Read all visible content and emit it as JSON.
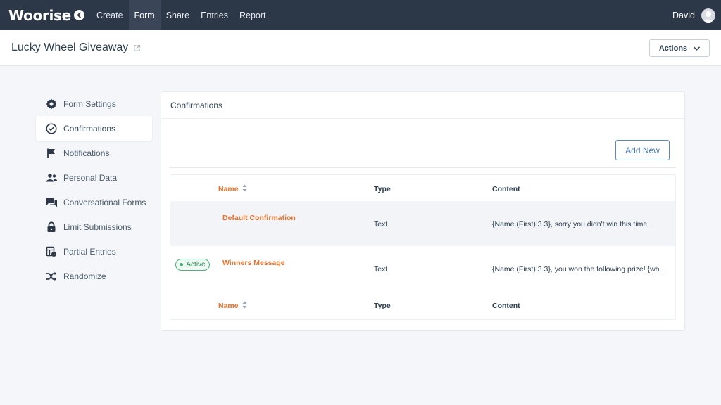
{
  "app": {
    "logo": "Woorise",
    "nav": [
      "Create",
      "Form",
      "Share",
      "Entries",
      "Report"
    ],
    "active_nav": "Form",
    "user_name": "David"
  },
  "header": {
    "title": "Lucky Wheel Giveaway",
    "actions_label": "Actions"
  },
  "sidebar": {
    "items": [
      {
        "label": "Form Settings",
        "icon": "gear-icon"
      },
      {
        "label": "Confirmations",
        "icon": "check-circle-icon"
      },
      {
        "label": "Notifications",
        "icon": "flag-icon"
      },
      {
        "label": "Personal Data",
        "icon": "users-icon"
      },
      {
        "label": "Conversational Forms",
        "icon": "chat-icon"
      },
      {
        "label": "Limit Submissions",
        "icon": "lock-icon"
      },
      {
        "label": "Partial Entries",
        "icon": "partial-entries-icon"
      },
      {
        "label": "Randomize",
        "icon": "shuffle-icon"
      }
    ],
    "active": "Confirmations"
  },
  "panel": {
    "title": "Confirmations",
    "add_label": "Add New",
    "columns": {
      "name": "Name",
      "type": "Type",
      "content": "Content"
    },
    "rows": [
      {
        "name": "Default Confirmation",
        "type": "Text",
        "content": "{Name (First):3.3}, sorry you didn't win this time.",
        "status": ""
      },
      {
        "name": "Winners Message",
        "type": "Text",
        "content": "{Name (First):3.3}, you won the following prize! {wh...",
        "status": "Active"
      }
    ]
  },
  "colors": {
    "topbar": "#2c3748",
    "accent_orange": "#e8722f",
    "active_green": "#4caf7a",
    "button_blue": "#4a7bb0"
  }
}
